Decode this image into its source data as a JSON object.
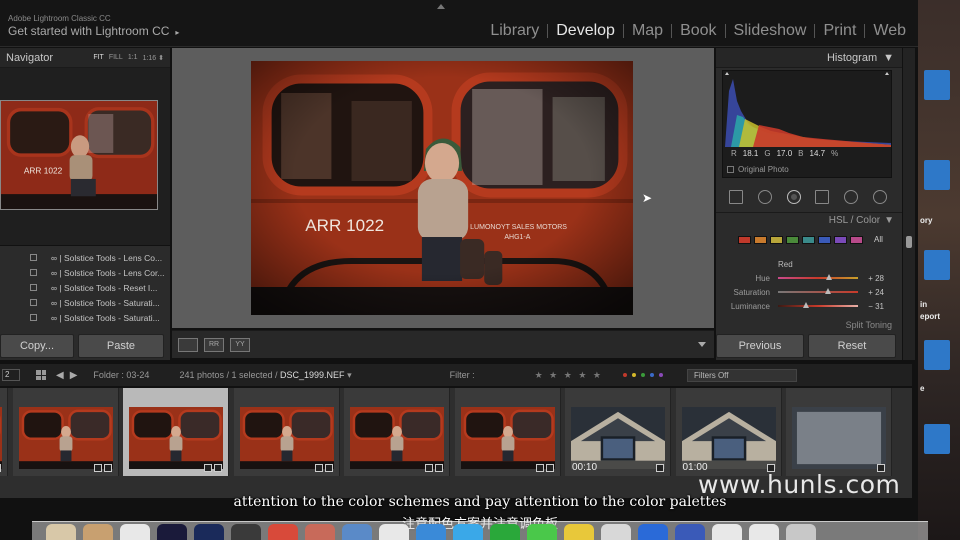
{
  "topbar": {
    "brand_small": "Adobe Lightroom Classic CC",
    "brand_big": "Get started with Lightroom CC",
    "brand_arrow": "▸",
    "modules": [
      "Library",
      "Develop",
      "Map",
      "Book",
      "Slideshow",
      "Print",
      "Web"
    ],
    "active_module": "Develop"
  },
  "navigator": {
    "title": "Navigator",
    "zoom_options": [
      "FIT",
      "FILL",
      "1:1",
      "1:16 ⬍"
    ],
    "active_zoom": "FIT"
  },
  "presets": [
    "∞ | Solstice Tools - Lens Co...",
    "∞ | Solstice Tools - Lens Cor...",
    "∞ | Solstice Tools - Reset I...",
    "∞ | Solstice Tools - Saturati...",
    "∞ | Solstice Tools - Saturati..."
  ],
  "left_buttons": {
    "copy": "Copy...",
    "paste": "Paste"
  },
  "toolbar": {
    "compare_a": "RR",
    "compare_b": "YY"
  },
  "histogram": {
    "title": "Histogram",
    "readout": {
      "r_label": "R",
      "r": "18.1",
      "g_label": "G",
      "g": "17.0",
      "b_label": "B",
      "b": "14.7",
      "unit": "%"
    },
    "original_photo": "Original Photo"
  },
  "hsl": {
    "title": "HSL / Color",
    "all_label": "All",
    "swatch_colors": [
      "#c0392b",
      "#c87a2d",
      "#b8a63a",
      "#4a8a3a",
      "#3a8a8a",
      "#3a5ab8",
      "#7a4ab8",
      "#b84a8a"
    ],
    "channel": "Red",
    "rows": [
      {
        "label": "Hue",
        "value": "+ 28",
        "level": 0.64
      },
      {
        "label": "Saturation",
        "value": "+ 24",
        "level": 0.62
      },
      {
        "label": "Luminance",
        "value": "− 31",
        "level": 0.35
      }
    ],
    "next_section": "Split Toning"
  },
  "right_buttons": {
    "previous": "Previous",
    "reset": "Reset"
  },
  "filmbar": {
    "page_num": "2",
    "folder": "Folder : 03-24",
    "count_prefix": "241 photos / 1 selected / ",
    "filename": "DSC_1999.NEF",
    "filename_arrow": "▾",
    "filter_label": "Filter :",
    "stars": "★ ★ ★ ★ ★",
    "label_colors": [
      "#c0392b",
      "#d4b82a",
      "#3a9a3a",
      "#3a6ac8",
      "#8a4ab8"
    ],
    "filters_off": "Filters Off"
  },
  "filmstrip": {
    "items": [
      {
        "kind": "photo"
      },
      {
        "kind": "photo"
      },
      {
        "kind": "photo",
        "selected": true
      },
      {
        "kind": "photo"
      },
      {
        "kind": "photo"
      },
      {
        "kind": "photo"
      },
      {
        "kind": "video",
        "duration": "00:10"
      },
      {
        "kind": "video",
        "duration": "01:00"
      },
      {
        "kind": "partial"
      }
    ]
  },
  "subtitles": {
    "english": "attention to the color schemes and pay attention to the color palettes",
    "chinese": "注意配色方案并注意调色板"
  },
  "watermark": "www.hunls.com",
  "desktop_labels": [
    "ory",
    "in",
    "eport",
    "e"
  ]
}
